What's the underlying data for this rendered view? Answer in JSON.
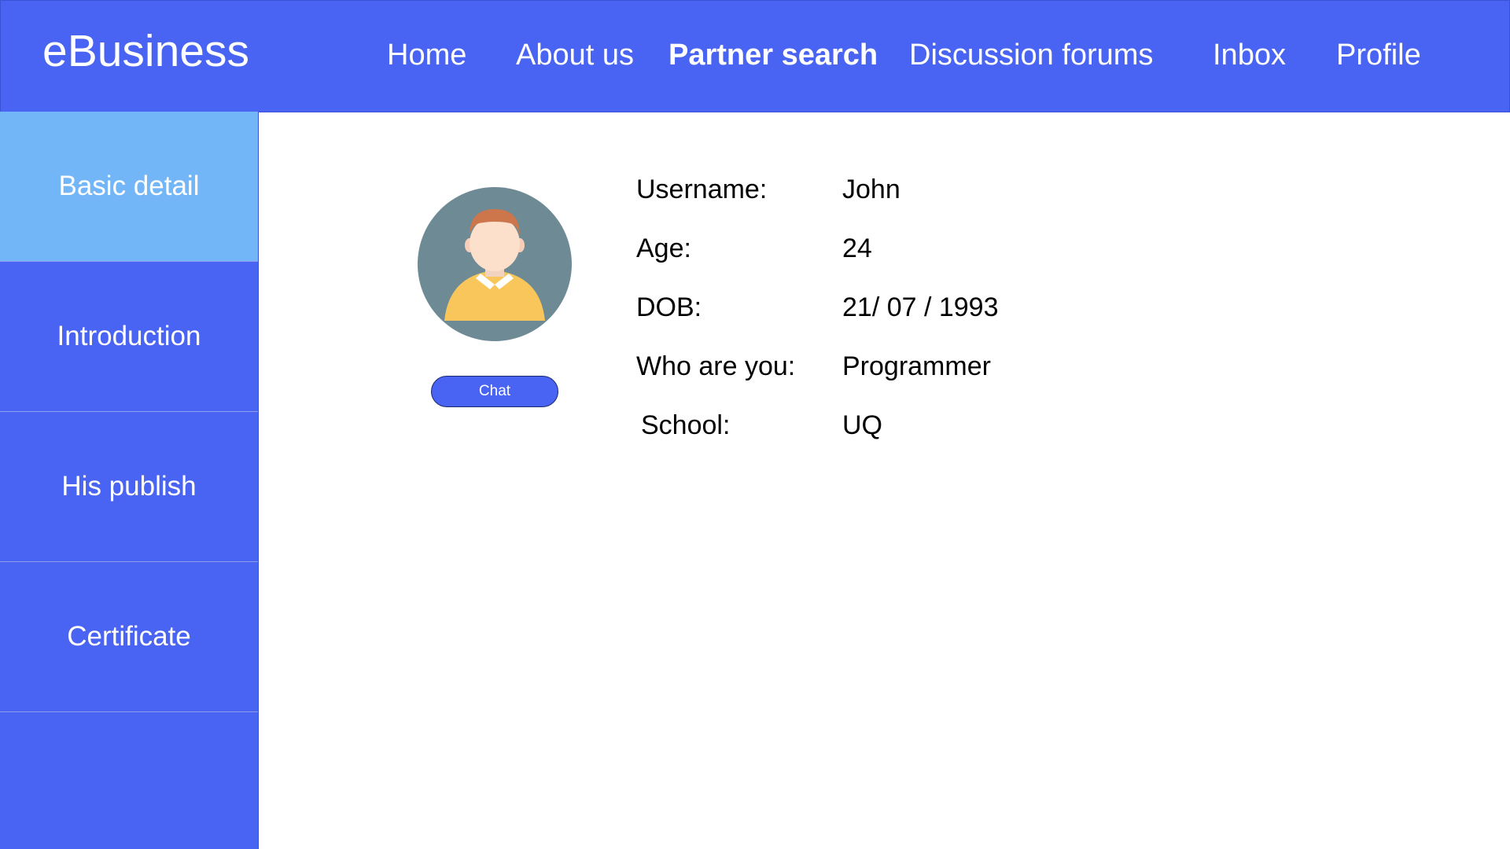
{
  "header": {
    "brand": "eBusiness",
    "nav": [
      "Home",
      "About us",
      "Partner search",
      "Discussion forums",
      "Inbox",
      "Profile"
    ],
    "active_nav": "Partner search"
  },
  "sidebar": {
    "items": [
      "Basic detail",
      "Introduction",
      "His publish",
      "Certificate"
    ],
    "active_item": "Basic detail"
  },
  "profile": {
    "avatar_icon": "user-avatar-icon",
    "chat_label": "Chat",
    "fields": [
      {
        "label": "Username:",
        "value": "John"
      },
      {
        "label": "Age:",
        "value": "24"
      },
      {
        "label": "DOB:",
        "value": "21/ 07 / 1993"
      },
      {
        "label": "Who are you:",
        "value": "Programmer"
      },
      {
        "label": "School:",
        "value": "UQ"
      }
    ]
  },
  "colors": {
    "primary": "#4964f2",
    "active_sidebar": "#72b6f8",
    "text_light": "#ffffff",
    "text_dark": "#000000"
  }
}
